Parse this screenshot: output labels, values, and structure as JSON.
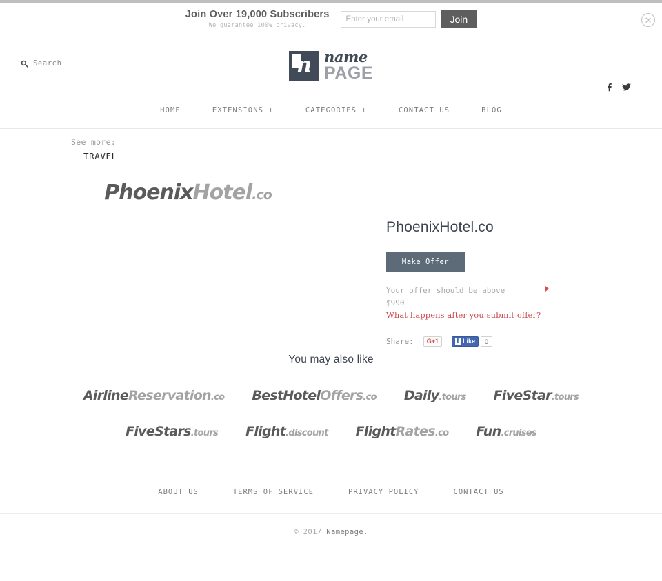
{
  "subscribe_bar": {
    "title": "Join Over 19,000 Subscribers",
    "subtitle": "We guarantee 100% privacy.",
    "email_placeholder": "Enter your email",
    "email_value": "",
    "join_label": "Join",
    "close_icon": "close-circle-icon"
  },
  "header": {
    "search_label": "Search",
    "search_icon": "search-icon",
    "logo": {
      "mark_letter": "n",
      "word_script": "name",
      "word_bold": "PAGE",
      "mark_color": "#404b57",
      "page_color": "#9aa0a6"
    },
    "social": [
      {
        "name": "facebook-icon",
        "title": "Facebook"
      },
      {
        "name": "twitter-icon",
        "title": "Twitter"
      }
    ]
  },
  "nav": {
    "items": [
      {
        "label": "HOME"
      },
      {
        "label": "EXTENSIONS +"
      },
      {
        "label": "CATEGORIES +"
      },
      {
        "label": "CONTACT US"
      },
      {
        "label": "BLOG"
      }
    ]
  },
  "see_more": {
    "label": "See more:",
    "category": "TRAVEL"
  },
  "domain_art": {
    "part1": "Phoenix",
    "part2": "Hotel",
    "tld": ".co"
  },
  "offer": {
    "domain_name": "PhoenixHotel.co",
    "make_offer_label": "Make Offer",
    "note_line1": "Your offer should be above",
    "note_line2": "$990",
    "minimum_offer": "$990",
    "help_link": "What happens after you submit offer?",
    "help_link_color": "#cc4b52",
    "button_color": "#5d6b78",
    "share": {
      "label": "Share:",
      "gplus_label": "G+1",
      "facebook_f": "f",
      "facebook_like_label": "Like",
      "facebook_count": "0"
    }
  },
  "also_like": {
    "title": "You may also like",
    "rows": [
      [
        {
          "part1": "Airline",
          "part2": "Reservation",
          "tld": ".co"
        },
        {
          "part1": "BestHotel",
          "part2": "Offers",
          "tld": ".co"
        },
        {
          "part1": "Daily",
          "part2": "",
          "tld": ".tours"
        },
        {
          "part1": "FiveStar",
          "part2": "",
          "tld": ".tours"
        }
      ],
      [
        {
          "part1": "FiveStars",
          "part2": "",
          "tld": ".tours"
        },
        {
          "part1": "Flight",
          "part2": "",
          "tld": ".discount"
        },
        {
          "part1": "Flight",
          "part2": "Rates",
          "tld": ".co"
        },
        {
          "part1": "Fun",
          "part2": "",
          "tld": ".cruises"
        }
      ]
    ]
  },
  "footer": {
    "links": [
      {
        "label": "ABOUT US"
      },
      {
        "label": "TERMS OF SERVICE"
      },
      {
        "label": "PRIVACY POLICY"
      },
      {
        "label": "CONTACT US"
      }
    ],
    "copyright_prefix": "© 2017 ",
    "copyright_name": "Namepage."
  }
}
